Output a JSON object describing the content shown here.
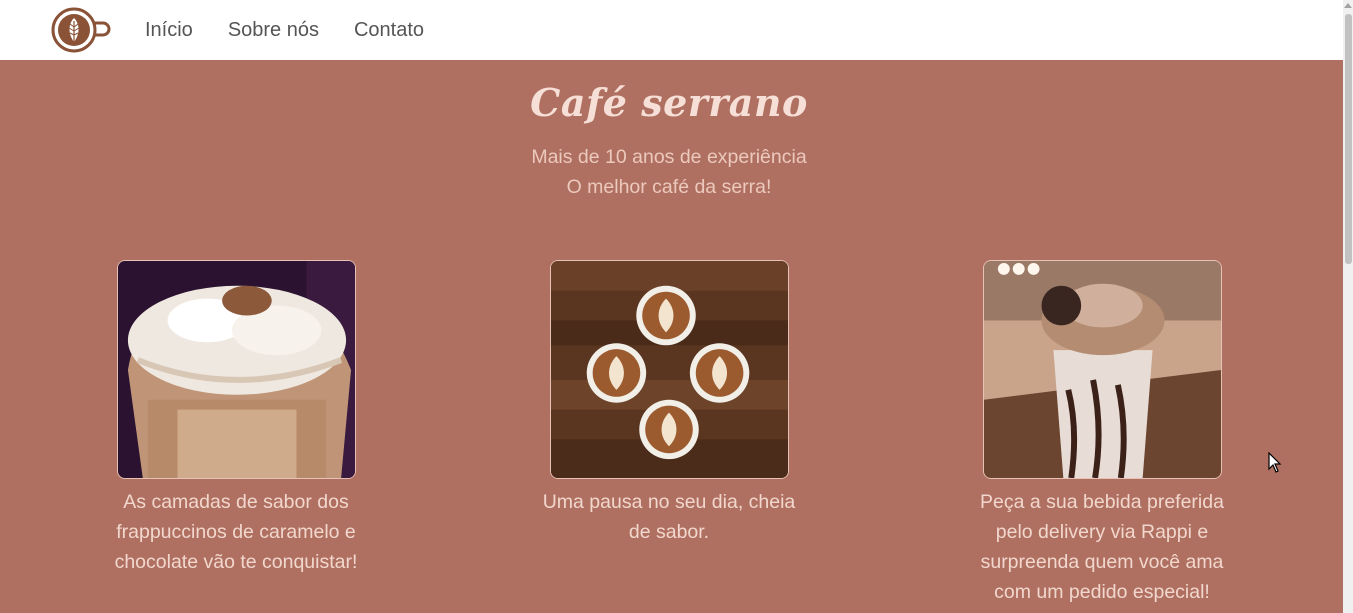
{
  "nav": {
    "logo_icon": "latte-art-cup-icon",
    "links": [
      "Início",
      "Sobre nós",
      "Contato"
    ]
  },
  "hero": {
    "title": "Café serrano",
    "subtitle_line1": "Mais de 10 anos de experiência",
    "subtitle_line2": "O melhor café da serra!"
  },
  "cards": [
    {
      "image": "caramel-chocolate-frappuccino-photo",
      "text": "As camadas de sabor dos frappuccinos de caramelo e chocolate vão te conquistar!"
    },
    {
      "image": "four-latte-art-cups-on-wood-photo",
      "text": "Uma pausa no seu dia, cheia de sabor."
    },
    {
      "image": "cookie-milkshake-with-chocolate-syrup-photo",
      "text": "Peça a sua bebida preferida pelo delivery via Rappi e surpreenda quem você ama com um pedido especial!"
    }
  ],
  "colors": {
    "main_bg": "#b07061",
    "title": "#f6dfd6",
    "text": "#f1d7cd",
    "logo_brown": "#8a5236"
  }
}
